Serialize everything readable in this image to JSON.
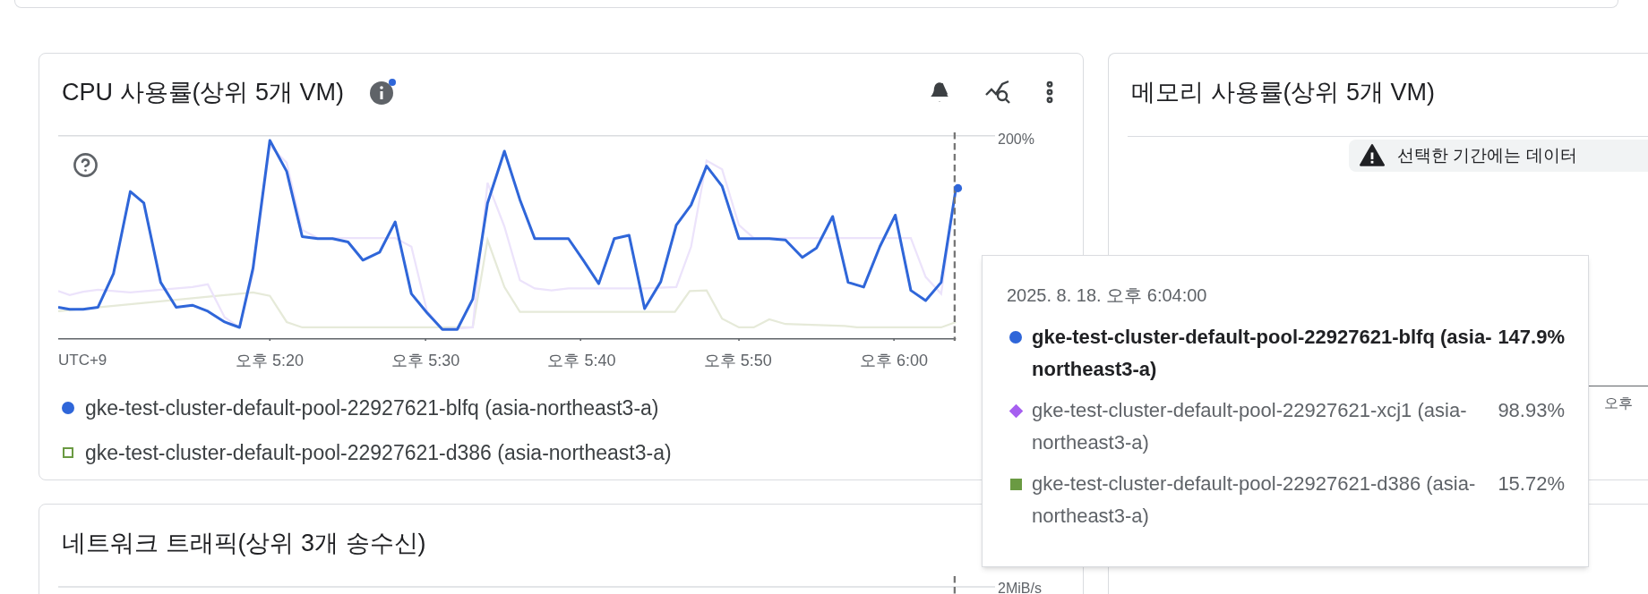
{
  "cpu_card": {
    "title": "CPU 사용률(상위 5개 VM)",
    "y_label": "200%",
    "timezone": "UTC+9",
    "ticks": [
      "오후 5:20",
      "오후 5:30",
      "오후 5:40",
      "오후 5:50",
      "오후 6:00"
    ],
    "legend": [
      {
        "label": "gke-test-cluster-default-pool-22927621-blfq (asia-northeast3-a)",
        "kind": "circle",
        "color": "#2f66d9"
      },
      {
        "label": "gke-test-cluster-default-pool-22927621-d386 (asia-northeast3-a)",
        "kind": "square_outline",
        "color": "#6a9a42"
      }
    ]
  },
  "memory_card": {
    "title": "메모리 사용률(상위 5개 VM)",
    "notice": "선택한 기간에는 데이터",
    "ticks": [
      "오후"
    ]
  },
  "network_card": {
    "title": "네트워크 트래픽(상위 3개 송수신)",
    "y_label": "2MiB/s"
  },
  "tooltip": {
    "time": "2025. 8. 18. 오후 6:04:00",
    "rows": [
      {
        "label": "gke-test-cluster-default-pool-22927621-blfq (asia-northeast3-a)",
        "value": "147.9%",
        "kind": "circle",
        "color": "#2f66d9",
        "highlighted": true
      },
      {
        "label": "gke-test-cluster-default-pool-22927621-xcj1 (asia-northeast3-a)",
        "value": "98.93%",
        "kind": "diamond",
        "color": "#a65ff0",
        "highlighted": false
      },
      {
        "label": "gke-test-cluster-default-pool-22927621-d386 (asia-northeast3-a)",
        "value": "15.72%",
        "kind": "square",
        "color": "#6a9a42",
        "highlighted": false
      }
    ]
  }
}
